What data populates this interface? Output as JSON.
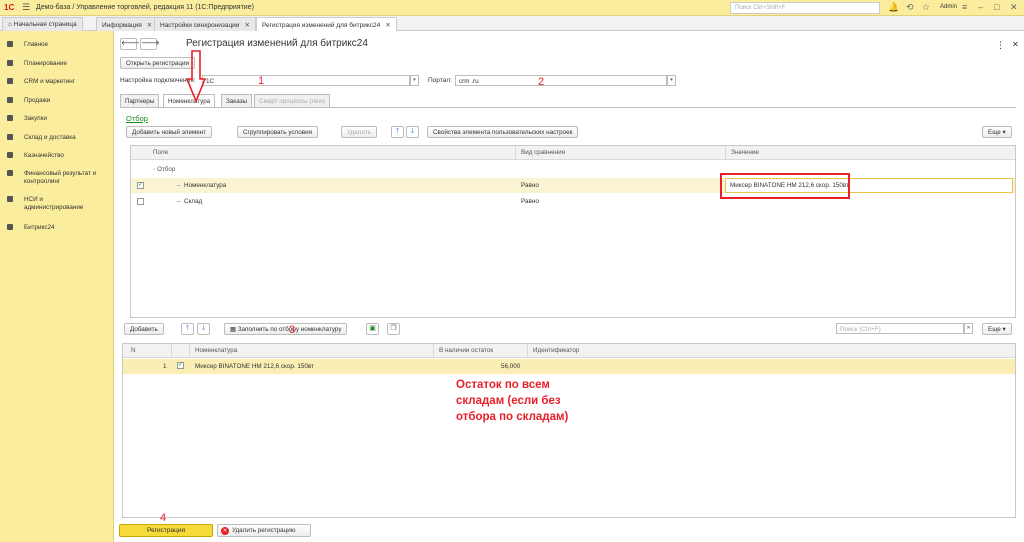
{
  "titlebar": {
    "logo": "1С",
    "title": "Демо-база / Управление торговлей, редакция 11  (1С:Предприятие)",
    "search_placeholder": "Поиск Ctrl+Shift+F",
    "user": "Admin"
  },
  "tabs": [
    {
      "label": "Начальная страница"
    },
    {
      "label": "Информация"
    },
    {
      "label": "Настройки синхронизации"
    },
    {
      "label": "Регистрация изменений для битрикс24"
    }
  ],
  "sidebar": {
    "items": [
      {
        "label": "Главное"
      },
      {
        "label": "Планирование"
      },
      {
        "label": "CRM и маркетинг"
      },
      {
        "label": "Продажи"
      },
      {
        "label": "Закупки"
      },
      {
        "label": "Склад и доставка"
      },
      {
        "label": "Казначейство"
      },
      {
        "label": "Финансовый результат и\nконтроллинг"
      },
      {
        "label": "НСИ и\nадминистрирование"
      },
      {
        "label": "Битрикс24"
      }
    ]
  },
  "form": {
    "title": "Регистрация изменений для битрикс24",
    "open_registered_btn": "Открыть регистрации",
    "connection_label": "Настройка подключения:",
    "connection_value": "1С",
    "portal_label": "Портал:",
    "portal_value": "crm                    .ru",
    "subtabs": [
      "Партнеры",
      "Номенклатура",
      "Заказы",
      "Смарт процессы (new)"
    ]
  },
  "filter": {
    "link": "Отбор",
    "add_btn": "Добавить новый элемент",
    "group_btn": "Сгруппировать условия",
    "delete_btn": "Удалить",
    "props_btn": "Свойства элемента пользовательских настроек",
    "more_btn": "Еще",
    "columns": {
      "field": "Поле",
      "comparison": "Вид сравнения",
      "value": "Значение"
    },
    "root": "Отбор",
    "rows": [
      {
        "field": "Номенклатура",
        "comparison": "Равно",
        "value": "Миксер BINATONE HM 212,6 скор. 150вт"
      },
      {
        "field": "Склад",
        "comparison": "Равно",
        "value": ""
      }
    ]
  },
  "goods": {
    "add_btn": "Добавить",
    "fill_btn": "Заполнить по отбору номенклатуру",
    "search_placeholder": "Поиск (Ctrl+F)",
    "more_btn": "Еще",
    "columns": {
      "n": "N",
      "name": "Номенклатура",
      "stock": "В наличии остаток",
      "id": "Идентификатор"
    },
    "rows": [
      {
        "n": "1",
        "name": "Миксер BINATONE HM 212,6 скор. 150вт",
        "stock": "56,000",
        "id": ""
      }
    ]
  },
  "annotations": {
    "n1": "1",
    "n2": "2",
    "n3": "3",
    "n4": "4",
    "note": "Остаток по всем\nскладам (если без\nотбора по складам)"
  },
  "footer": {
    "register_btn": "Регистрация",
    "delete_reg_btn": "Удалить регистрацию"
  }
}
